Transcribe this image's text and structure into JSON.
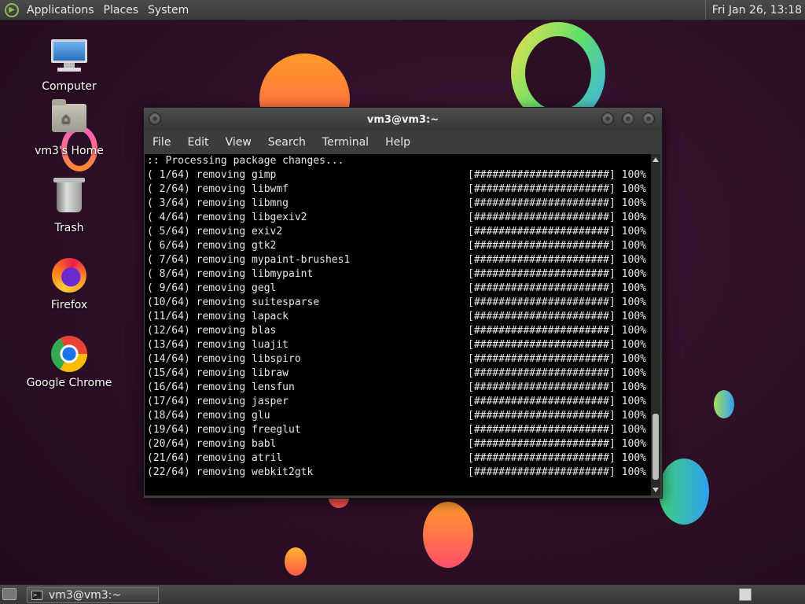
{
  "top_panel": {
    "menus": [
      "Applications",
      "Places",
      "System"
    ],
    "clock": "Fri Jan 26, 13:18"
  },
  "desktop_icons": [
    {
      "label": "Computer",
      "icon": "computer-icon"
    },
    {
      "label": "vm3's Home",
      "icon": "home-folder-icon"
    },
    {
      "label": "Trash",
      "icon": "trash-icon"
    },
    {
      "label": "Firefox",
      "icon": "firefox-icon"
    },
    {
      "label": "Google Chrome",
      "icon": "chrome-icon"
    }
  ],
  "terminal": {
    "title": "vm3@vm3:~",
    "menus": [
      "File",
      "Edit",
      "View",
      "Search",
      "Terminal",
      "Help"
    ],
    "header_line": ":: Processing package changes...",
    "progress_bar": "[######################] 100%",
    "lines": [
      "( 1/64) removing gimp",
      "( 2/64) removing libwmf",
      "( 3/64) removing libmng",
      "( 4/64) removing libgexiv2",
      "( 5/64) removing exiv2",
      "( 6/64) removing gtk2",
      "( 7/64) removing mypaint-brushes1",
      "( 8/64) removing libmypaint",
      "( 9/64) removing gegl",
      "(10/64) removing suitesparse",
      "(11/64) removing lapack",
      "(12/64) removing blas",
      "(13/64) removing luajit",
      "(14/64) removing libspiro",
      "(15/64) removing libraw",
      "(16/64) removing lensfun",
      "(17/64) removing jasper",
      "(18/64) removing glu",
      "(19/64) removing freeglut",
      "(20/64) removing babl",
      "(21/64) removing atril",
      "(22/64) removing webkit2gtk"
    ]
  },
  "bottom_panel": {
    "task_label": "vm3@vm3:~"
  },
  "colors": {
    "terminal_bg": "#000000",
    "terminal_fg": "#e6e6e6",
    "panel_bg": "#3a3a3a",
    "wallpaper_bg": "#2b0f25"
  }
}
